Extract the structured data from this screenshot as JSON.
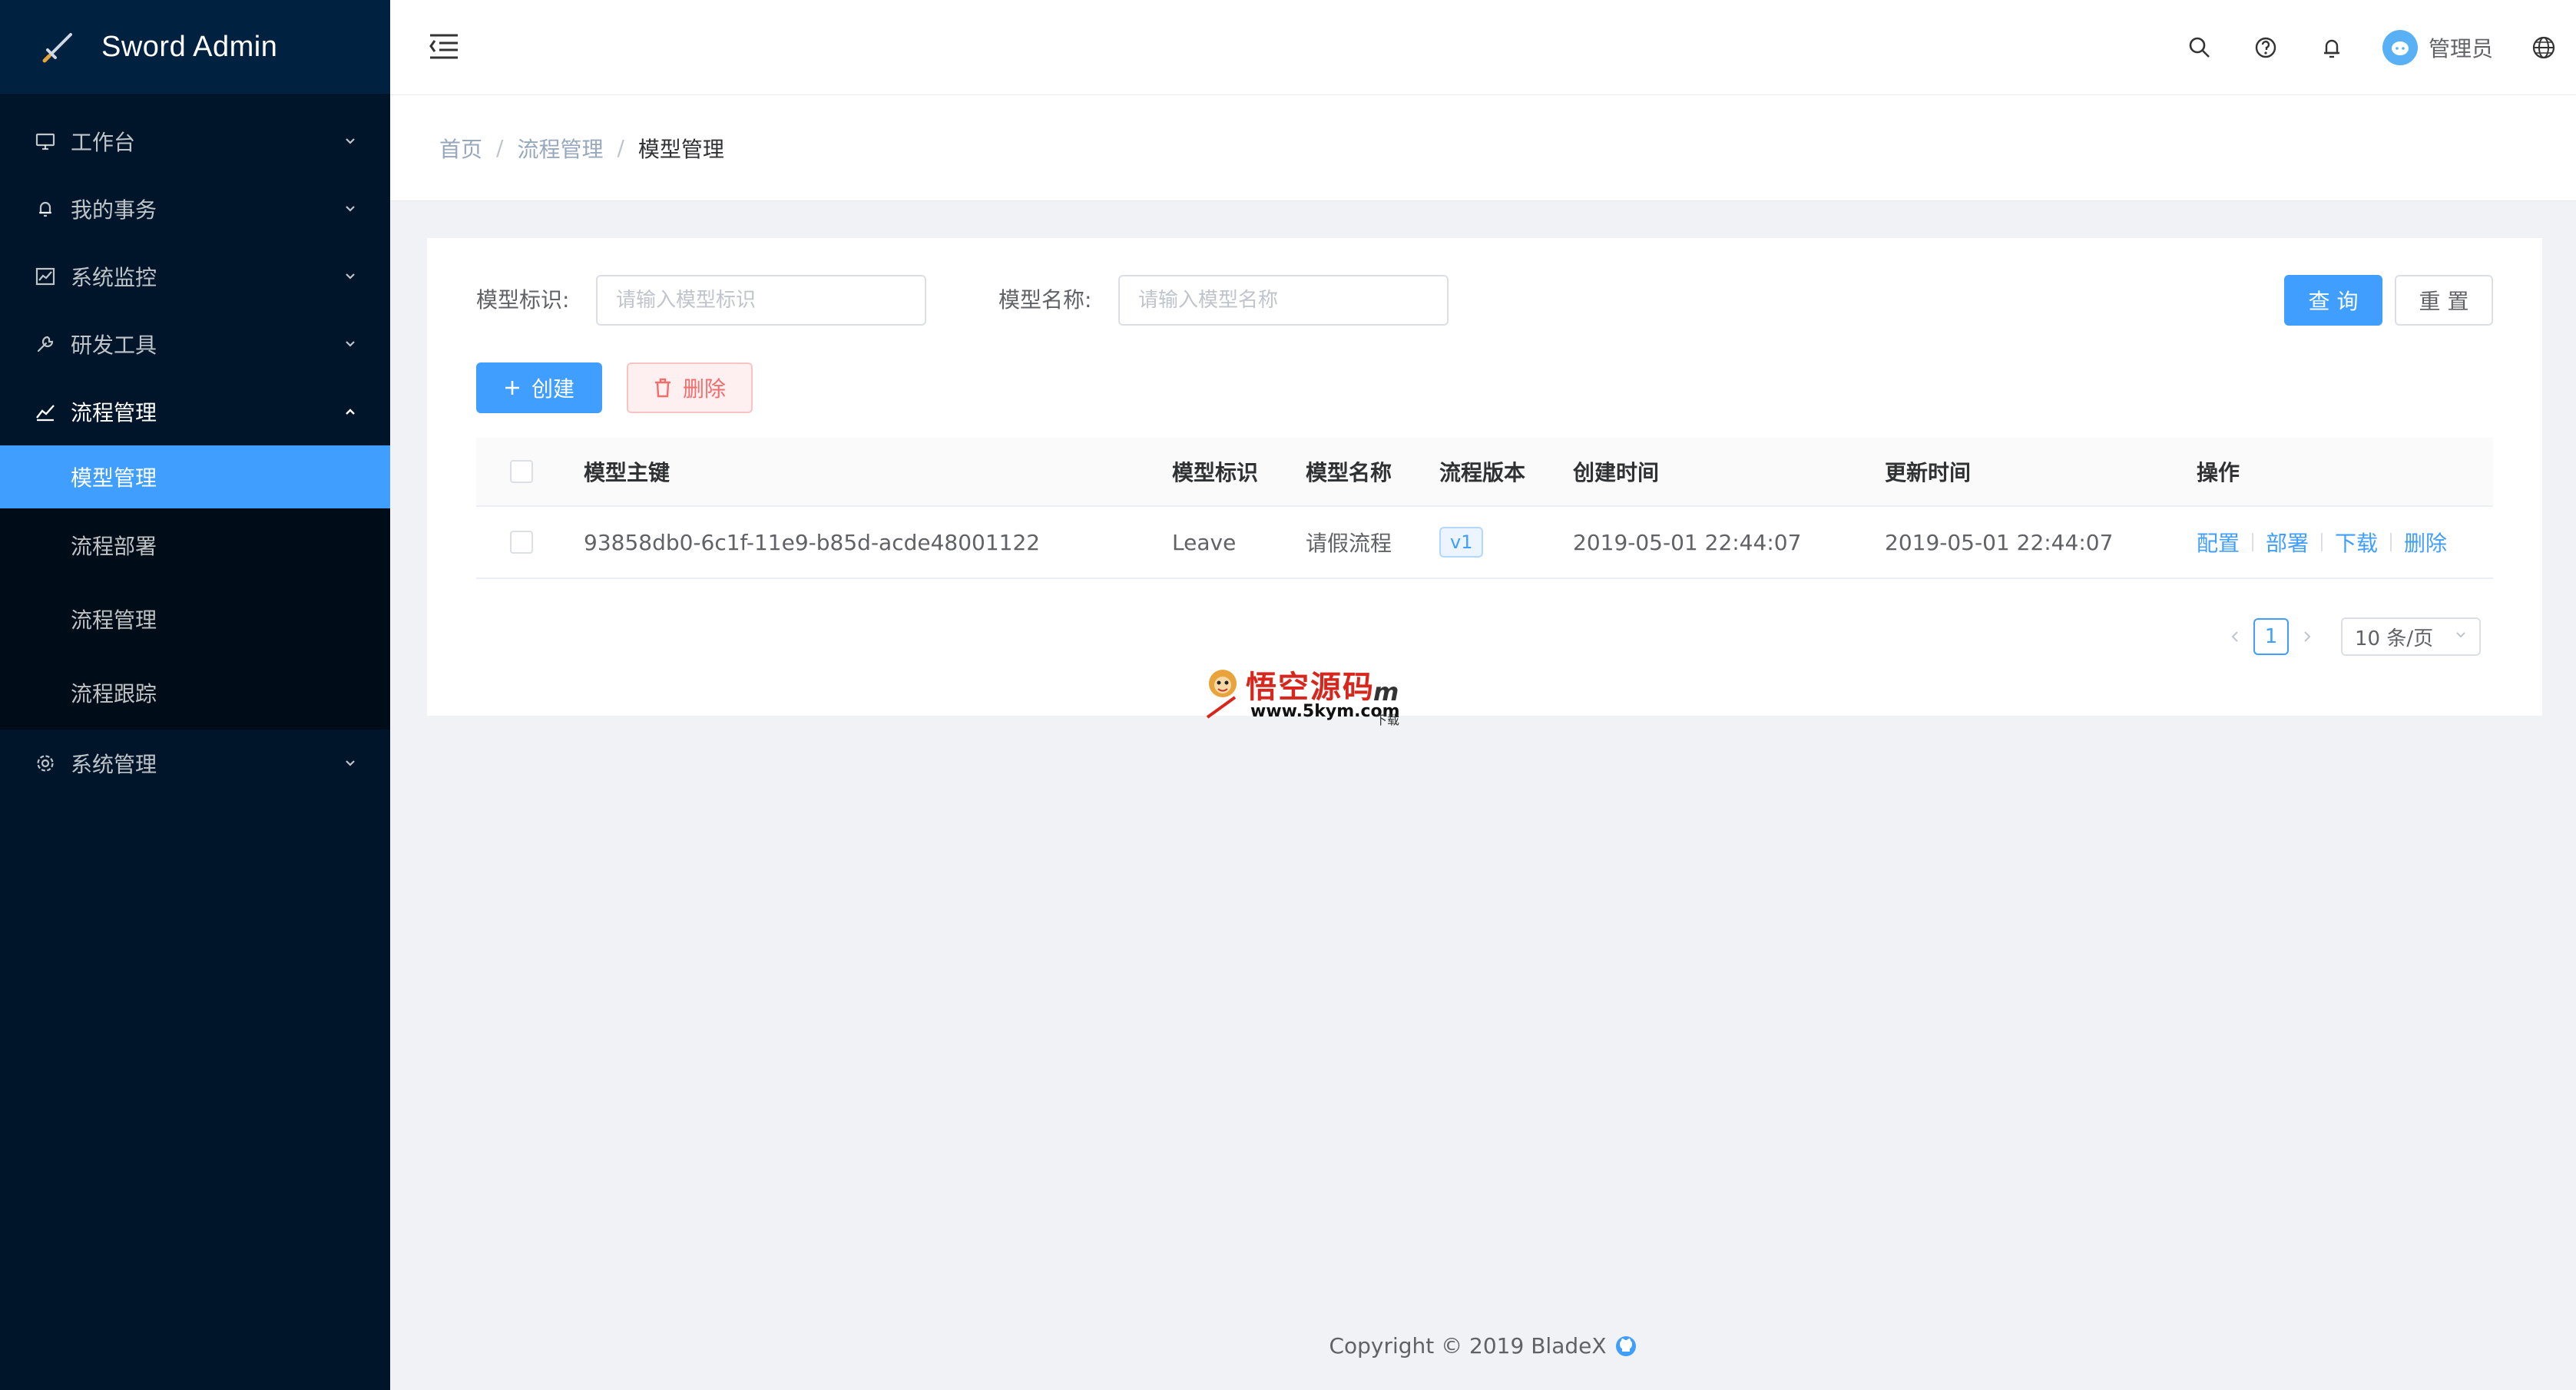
{
  "app": {
    "title": "Sword Admin"
  },
  "sidebar": {
    "items": [
      {
        "label": "工作台",
        "icon": "monitor-icon",
        "open": false
      },
      {
        "label": "我的事务",
        "icon": "bell-icon",
        "open": false
      },
      {
        "label": "系统监控",
        "icon": "chart-icon",
        "open": false
      },
      {
        "label": "研发工具",
        "icon": "wrench-icon",
        "open": false
      },
      {
        "label": "流程管理",
        "icon": "line-chart-icon",
        "open": true,
        "children": [
          {
            "label": "模型管理",
            "active": true
          },
          {
            "label": "流程部署",
            "active": false
          },
          {
            "label": "流程管理",
            "active": false
          },
          {
            "label": "流程跟踪",
            "active": false
          }
        ]
      },
      {
        "label": "系统管理",
        "icon": "gear-icon",
        "open": false
      }
    ]
  },
  "header": {
    "user_name": "管理员"
  },
  "breadcrumb": [
    "首页",
    "流程管理",
    "模型管理"
  ],
  "search": {
    "key_label": "模型标识:",
    "key_placeholder": "请输入模型标识",
    "key_value": "",
    "name_label": "模型名称:",
    "name_placeholder": "请输入模型名称",
    "name_value": "",
    "query_label": "查 询",
    "reset_label": "重 置"
  },
  "toolbar": {
    "create_label": "创建",
    "delete_label": "删除"
  },
  "table": {
    "columns": [
      "模型主键",
      "模型标识",
      "模型名称",
      "流程版本",
      "创建时间",
      "更新时间",
      "操作"
    ],
    "rows": [
      {
        "id": "93858db0-6c1f-11e9-b85d-acde48001122",
        "key": "Leave",
        "name": "请假流程",
        "version": "v1",
        "created": "2019-05-01 22:44:07",
        "updated": "2019-05-01 22:44:07",
        "actions": [
          "配置",
          "部署",
          "下载",
          "删除"
        ]
      }
    ]
  },
  "pagination": {
    "current": "1",
    "page_size": "10 条/页"
  },
  "watermark": {
    "title": "悟空源码",
    "url": "www.5kym.com",
    "suffix": "m",
    "small": "下载"
  },
  "footer": {
    "text": "Copyright © 2019 BladeX"
  },
  "colors": {
    "primary": "#409eff",
    "sidebar": "#001529",
    "danger": "#f56c6c"
  }
}
